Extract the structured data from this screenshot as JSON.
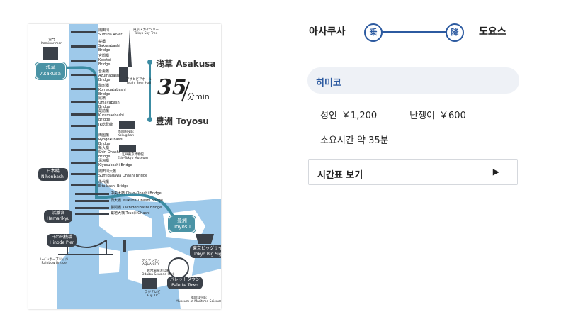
{
  "route": {
    "from_station": "아사쿠사",
    "to_station": "도요스",
    "board_badge": "乗",
    "alight_badge": "降",
    "line_color": "#2c5aa0"
  },
  "boat": {
    "name": "히미코"
  },
  "fares": {
    "adult_label": "성인",
    "adult_price": "￥1,200",
    "child_label": "난쟁이",
    "child_price": "￥600"
  },
  "duration": {
    "label": "소요시간",
    "value": "약 35분"
  },
  "timetable": {
    "label": "시간표 보기",
    "arrow_icon": "play-arrow-icon"
  },
  "map": {
    "river_color": "#9ec9ea",
    "route_color": "#3c8ca3",
    "origin": {
      "jp": "浅草",
      "en": "Asakusa"
    },
    "destination": {
      "jp": "豊洲",
      "en": "Toyosu"
    },
    "duration_number": "35",
    "duration_unit": "分min",
    "kaminarimon": "雷門\nKaminarimon",
    "skytree": "東京スカイツリー\nTokyo Sky Tree",
    "asahi": "アサヒビアホール\nAsahi Beer Hall",
    "kokugikan": "両国国技館\nKokugikan",
    "edo_museum": "江戸東京博物館\nEdo-Tokyo Museum",
    "piers": {
      "asakusa": "浅草\nAsakusa",
      "nihonbashi": "日本橋\nNihonbashi",
      "hamarikyu": "浜離宮\nHamarikyu",
      "hinode": "日の出桟橋\nHinode Pier",
      "toyosu": "豊洲\nToyosu",
      "big_sight": "東京ビッグサイト\nTokyo Big Sight",
      "palette": "パレットタウン\nPalette Town"
    },
    "bridges": [
      "隅田川\nSumida River",
      "桜橋\nSakurabashi\nBridge",
      "言問橋\nKototoi\nBridge",
      "吾妻橋\nAzumabashi\nBridge",
      "駒形橋\nKomagatabashi\nBridge",
      "厩橋\nUmayabashi\nBridge",
      "蔵前橋\nKuramaebashi\nBridge",
      "JR総武線",
      "両国橋\nRyogokubashi\nBridge",
      "新大橋\nShin-Ohashi\nBridge",
      "清洲橋\nKiyosubashi Bridge",
      "隅田川大橋\nSumidagawa Ohashi Bridge",
      "永代橋\nEitaibashi Bridge",
      "中央大橋 Chuo-Ohashi Bridge",
      "佃大橋 Tsukuda-Ohashi Bridge",
      "勝鬨橋 KachidokiBashi Bridge",
      "築地大橋 Tsukiji Ohashi"
    ],
    "rainbow": "レインボーブリッジ\nRainbow Bridge",
    "aqua_city": "アクアシティ\nAQUA CITY",
    "odaiba_park": "お台場海浜公園\nOdaiba Seaside Park",
    "fuji_tv": "フジテレビ\nFuji TV",
    "maritime": "船の科学館\nMuseum of Maritime Science"
  }
}
